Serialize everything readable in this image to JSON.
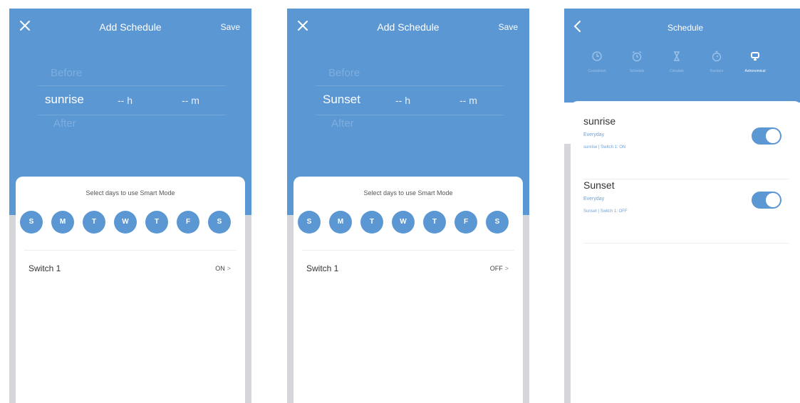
{
  "colors": {
    "accent": "#5b97d3",
    "sheet": "#ffffff",
    "muted_text": "#7eaedd"
  },
  "screens": [
    {
      "header": {
        "title": "Add Schedule",
        "save_label": "Save",
        "close_icon": "close-icon"
      },
      "picker": {
        "before": "Before",
        "event": "sunrise",
        "hours": "-- h",
        "minutes": "-- m",
        "after": "After"
      },
      "sheet": {
        "title": "Select days to use Smart Mode",
        "days": [
          "S",
          "M",
          "T",
          "W",
          "T",
          "F",
          "S"
        ],
        "row": {
          "label": "Switch 1",
          "value": "ON",
          "chevron": ">"
        }
      }
    },
    {
      "header": {
        "title": "Add Schedule",
        "save_label": "Save",
        "close_icon": "close-icon"
      },
      "picker": {
        "before": "Before",
        "event": "Sunset",
        "hours": "-- h",
        "minutes": "-- m",
        "after": "After"
      },
      "sheet": {
        "title": "Select days to use Smart Mode",
        "days": [
          "S",
          "M",
          "T",
          "W",
          "T",
          "F",
          "S"
        ],
        "row": {
          "label": "Switch 1",
          "value": "OFF",
          "chevron": ">"
        }
      }
    }
  ],
  "schedule": {
    "title": "Schedule",
    "back_icon": "chevron-left-icon",
    "tabs": [
      {
        "label": "Countdown",
        "icon": "clock-icon",
        "active": false
      },
      {
        "label": "Schedule",
        "icon": "alarm-icon",
        "active": false
      },
      {
        "label": "Circulate",
        "icon": "hourglass-icon",
        "active": false
      },
      {
        "label": "Random",
        "icon": "timer-icon",
        "active": false
      },
      {
        "label": "Astronomical",
        "icon": "astronomical-icon",
        "active": true
      }
    ],
    "items": [
      {
        "name": "sunrise",
        "repeat": "Everyday",
        "action": "sunrise | Switch 1: ON",
        "enabled": true
      },
      {
        "name": "Sunset",
        "repeat": "Everyday",
        "action": "Sunset | Switch 1: OFF",
        "enabled": true
      }
    ]
  }
}
